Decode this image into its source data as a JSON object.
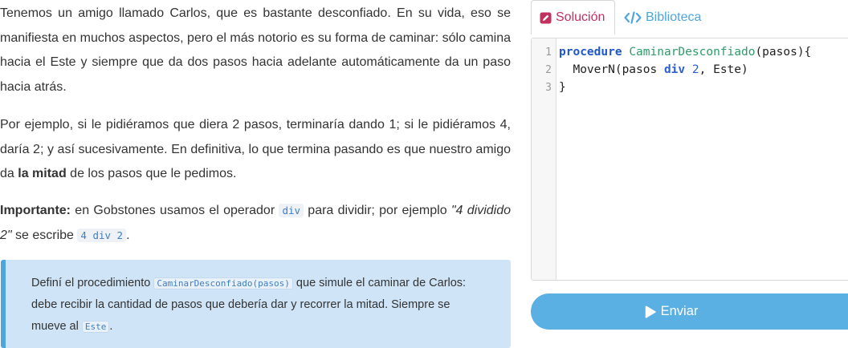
{
  "exercise": {
    "p1": "Tenemos un amigo llamado Carlos, que es bastante desconfiado. En su vida, eso se manifiesta en muchos aspectos, pero el más notorio es su forma de caminar: sólo camina hacia el Este y siempre que da dos pasos hacia adelante automáticamente da un paso hacia atrás.",
    "p2_before": "Por ejemplo, si le pidiéramos que diera 2 pasos, terminaría dando 1; si le pidiéramos 4, daría 2; y así sucesivamente. En definitiva, lo que termina pasando es que nuestro amigo da ",
    "p2_bold": "la mitad",
    "p2_after": " de los pasos que le pedimos.",
    "p3_bold": "Importante:",
    "p3_text1": " en Gobstones usamos el operador ",
    "p3_code1": "div",
    "p3_text2": " para dividir; por ejemplo ",
    "p3_italic": "\"4 dividido 2\"",
    "p3_text3": " se escribe ",
    "p3_code2": "4 div 2",
    "p3_text4": ".",
    "callout_text1": "Definí el procedimiento ",
    "callout_code1": "CaminarDesconfiado(pasos)",
    "callout_text2": " que simule el caminar de Carlos: debe recibir la cantidad de pasos que debería dar y recorrer la mitad. Siempre se mueve al ",
    "callout_code2": "Este",
    "callout_text3": "."
  },
  "tabs": {
    "solucion": "Solución",
    "biblioteca": "Biblioteca"
  },
  "editor": {
    "line_numbers": [
      "1",
      "2",
      "3"
    ],
    "line1_kw": "procedure",
    "line1_name": "CaminarDesconfiado",
    "line1_rest": "(pasos){",
    "line2_a": "  MoverN(pasos ",
    "line2_op": "div",
    "line2_b": " ",
    "line2_num": "2",
    "line2_c": ", Este)",
    "line3": "}"
  },
  "actions": {
    "send_label": "Enviar"
  },
  "colors": {
    "accent_blue": "#5bb0e3",
    "solution_pink": "#c2305f",
    "callout_bg": "#cfe4f6"
  },
  "icons": [
    "edit-icon",
    "code-icon",
    "play-icon"
  ]
}
